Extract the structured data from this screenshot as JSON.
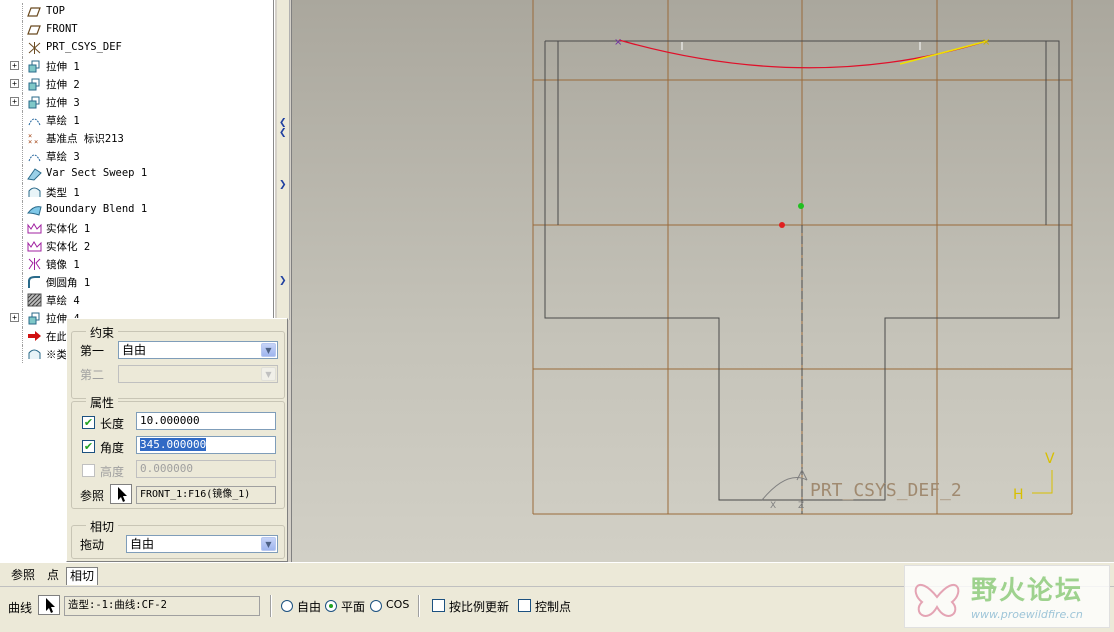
{
  "tree": {
    "items": [
      {
        "label": "TOP",
        "icon": "datum-plane-icon",
        "expander": false
      },
      {
        "label": "FRONT",
        "icon": "datum-plane-icon",
        "expander": false
      },
      {
        "label": "PRT_CSYS_DEF",
        "icon": "csys-icon",
        "expander": false
      },
      {
        "label": "拉伸 1",
        "icon": "extrude-icon",
        "expander": true
      },
      {
        "label": "拉伸 2",
        "icon": "extrude-icon",
        "expander": true
      },
      {
        "label": "拉伸 3",
        "icon": "extrude-icon",
        "expander": true
      },
      {
        "label": "草绘 1",
        "icon": "sketch-icon",
        "expander": false
      },
      {
        "label": "基准点 标识213",
        "icon": "datum-point-icon",
        "expander": false
      },
      {
        "label": "草绘 3",
        "icon": "sketch-icon",
        "expander": false
      },
      {
        "label": "Var Sect Sweep 1",
        "icon": "sweep-icon",
        "expander": false
      },
      {
        "label": "类型 1",
        "icon": "style-icon",
        "expander": false
      },
      {
        "label": "Boundary Blend 1",
        "icon": "blend-icon",
        "expander": false
      },
      {
        "label": "实体化 1",
        "icon": "solidify-icon",
        "expander": false
      },
      {
        "label": "实体化 2",
        "icon": "solidify-icon",
        "expander": false
      },
      {
        "label": "镜像 1",
        "icon": "mirror-icon",
        "expander": false
      },
      {
        "label": "倒圆角 1",
        "icon": "round-icon",
        "expander": false
      },
      {
        "label": "草绘 4",
        "icon": "sketch-hatch-icon",
        "expander": false
      },
      {
        "label": "拉伸 4",
        "icon": "extrude-icon",
        "expander": true
      },
      {
        "label": "在此",
        "icon": "insert-here-icon",
        "expander": false
      },
      {
        "label": "※类",
        "icon": "style-icon",
        "expander": false
      }
    ]
  },
  "dialog": {
    "constraint": {
      "title": "约束",
      "first_label": "第一",
      "first_value": "自由",
      "second_label": "第二",
      "second_value": ""
    },
    "properties": {
      "title": "属性",
      "length_label": "长度",
      "length_value": "10.000000",
      "angle_label": "角度",
      "angle_value": "345.000000",
      "height_label": "高度",
      "height_value": "0.000000",
      "ref_label": "参照",
      "ref_value": "FRONT_1:F16(镜像_1)"
    },
    "tangent": {
      "title": "相切",
      "drag_label": "拖动",
      "drag_value": "自由"
    }
  },
  "tabs": [
    {
      "label": "参照",
      "active": false
    },
    {
      "label": "点",
      "active": false
    },
    {
      "label": "相切",
      "active": true
    }
  ],
  "dashboard": {
    "curve_label": "曲线",
    "curve_value": "造型:-1:曲线:CF-2",
    "radio_free": "自由",
    "radio_plane": "平面",
    "radio_cos": "COS",
    "scale_update": "按比例更新",
    "control_points": "控制点"
  },
  "viewport": {
    "csys_label": "PRT_CSYS_DEF_2",
    "axis_h": "H",
    "axis_v": "V",
    "axis_x": "X",
    "axis_z": "Z"
  },
  "watermark": {
    "title": "野火论坛",
    "url": "www.proewildfire.cn"
  },
  "colors": {
    "curve": "#e0102a",
    "tangent": "#f0e000",
    "grid": "#9a6a3a",
    "outline": "#4a4a4a"
  }
}
